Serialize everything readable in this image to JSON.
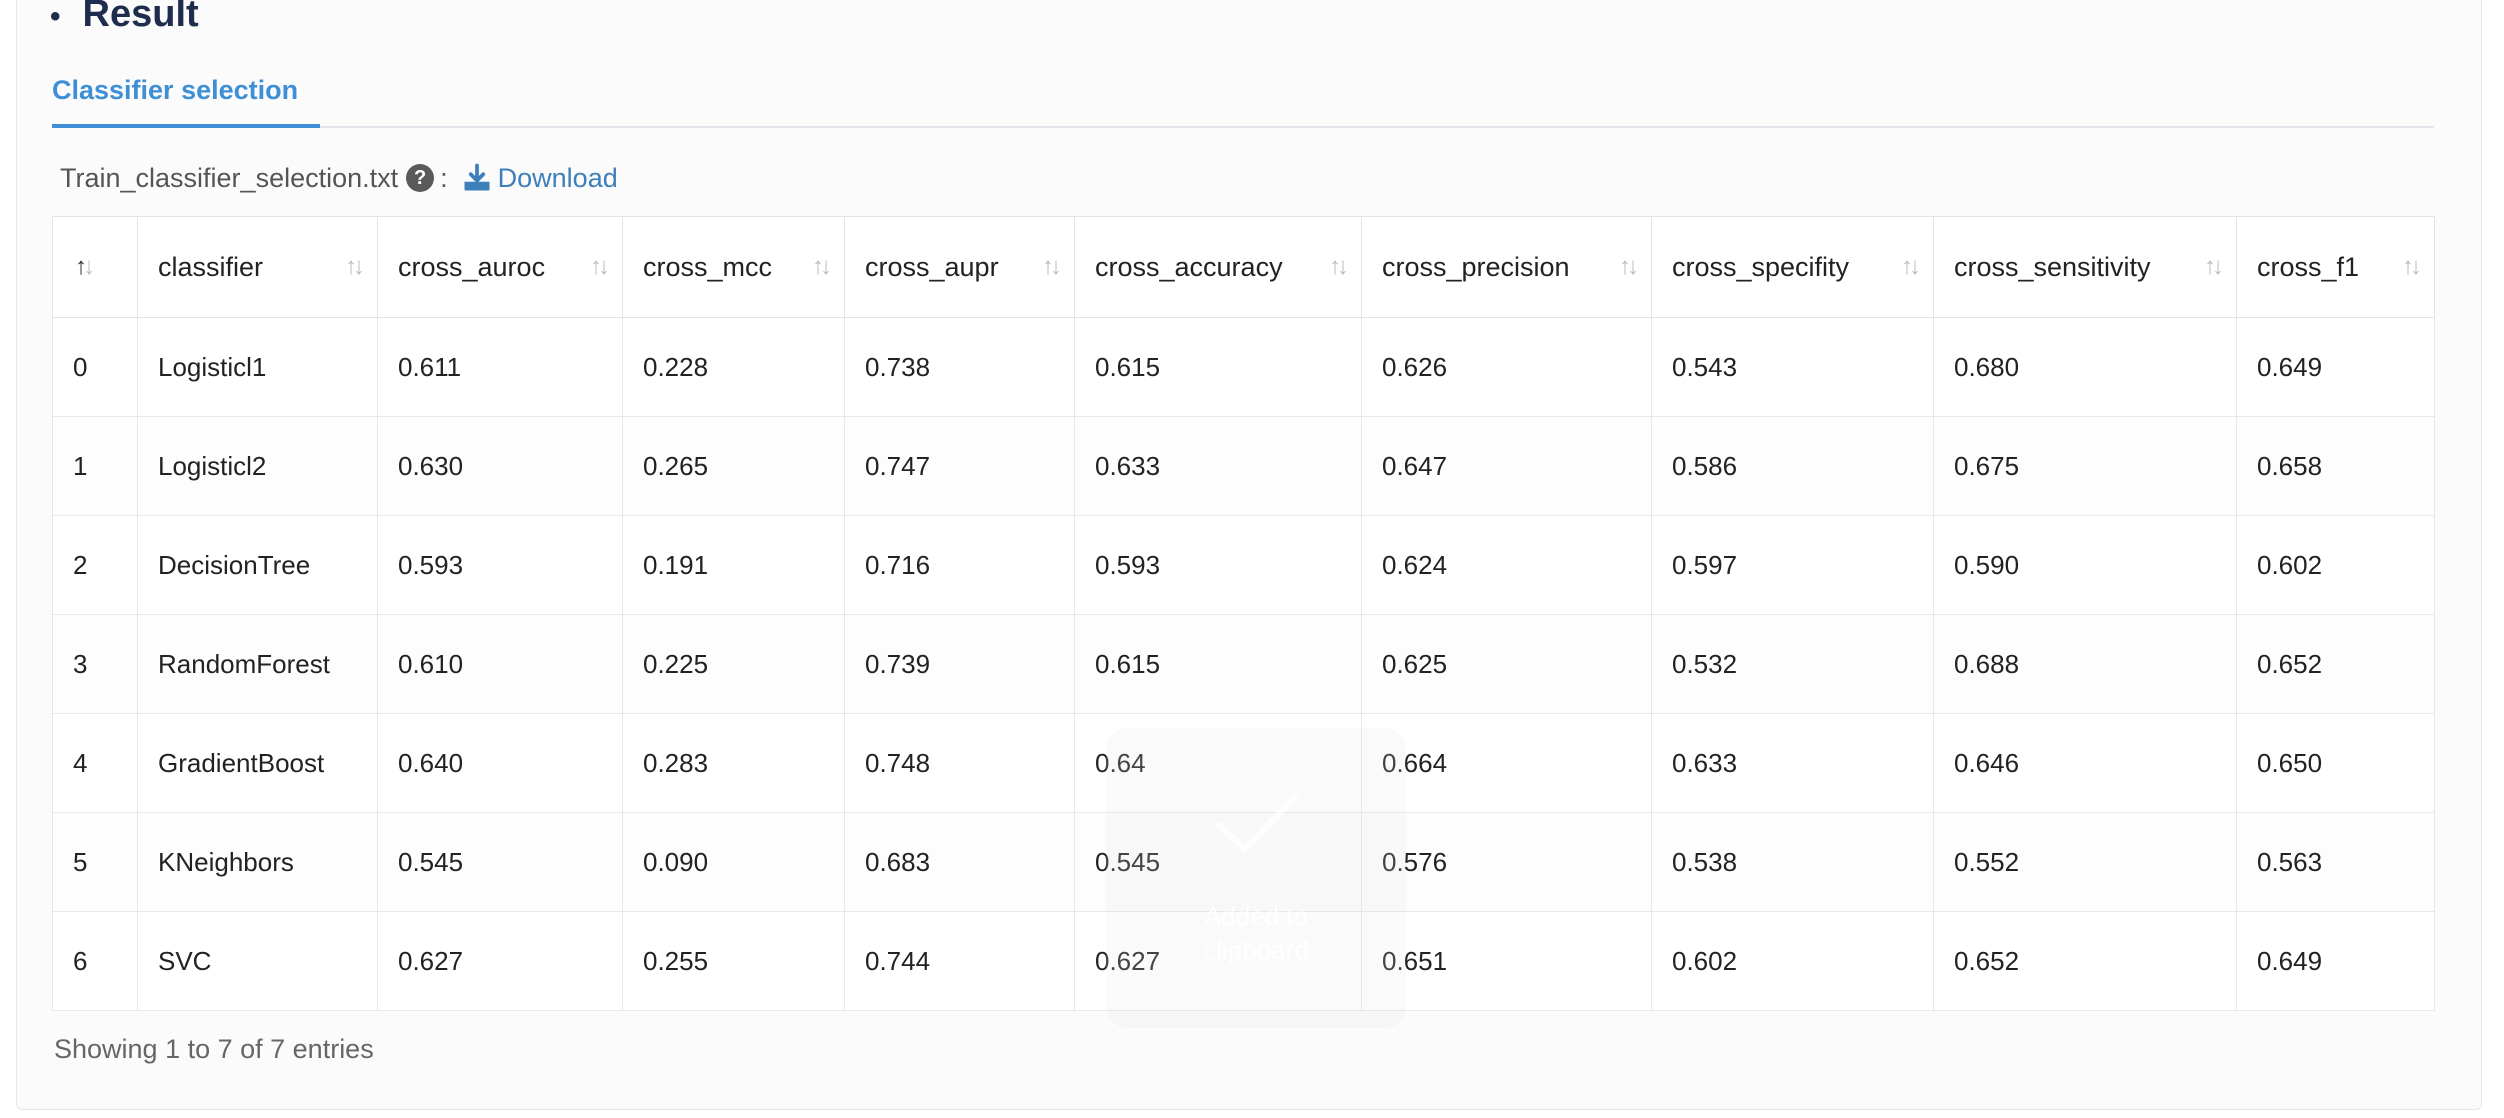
{
  "section": {
    "bullet": "•",
    "title": "Result"
  },
  "tabs": [
    {
      "label": "Classifier selection"
    }
  ],
  "file": {
    "name": "Train_classifier_selection.txt",
    "help": "?",
    "colon": ":",
    "download_label": "Download"
  },
  "table": {
    "columns": [
      "",
      "classifier",
      "cross_auroc",
      "cross_mcc",
      "cross_aupr",
      "cross_accuracy",
      "cross_precision",
      "cross_specifity",
      "cross_sensitivity",
      "cross_f1"
    ],
    "rows": [
      [
        "0",
        "Logisticl1",
        "0.611",
        "0.228",
        "0.738",
        "0.615",
        "0.626",
        "0.543",
        "0.680",
        "0.649"
      ],
      [
        "1",
        "Logisticl2",
        "0.630",
        "0.265",
        "0.747",
        "0.633",
        "0.647",
        "0.586",
        "0.675",
        "0.658"
      ],
      [
        "2",
        "DecisionTree",
        "0.593",
        "0.191",
        "0.716",
        "0.593",
        "0.624",
        "0.597",
        "0.590",
        "0.602"
      ],
      [
        "3",
        "RandomForest",
        "0.610",
        "0.225",
        "0.739",
        "0.615",
        "0.625",
        "0.532",
        "0.688",
        "0.652"
      ],
      [
        "4",
        "GradientBoost",
        "0.640",
        "0.283",
        "0.748",
        "0.64",
        "0.664",
        "0.633",
        "0.646",
        "0.650"
      ],
      [
        "5",
        "KNeighbors",
        "0.545",
        "0.090",
        "0.683",
        "0.545",
        "0.576",
        "0.538",
        "0.552",
        "0.563"
      ],
      [
        "6",
        "SVC",
        "0.627",
        "0.255",
        "0.744",
        "0.627",
        "0.651",
        "0.602",
        "0.652",
        "0.649"
      ]
    ]
  },
  "footer": {
    "info": "Showing 1 to 7 of 7 entries"
  },
  "toast": {
    "line1": "Added to",
    "line2": "clipboard"
  },
  "icons": {
    "help": "question-circle-icon",
    "download": "download-icon",
    "sort": "sort-arrows-icon",
    "toast": "checkmark-icon"
  },
  "colors": {
    "accent": "#3e8fd6",
    "title": "#1f2c4d",
    "link": "#3e7fba"
  }
}
